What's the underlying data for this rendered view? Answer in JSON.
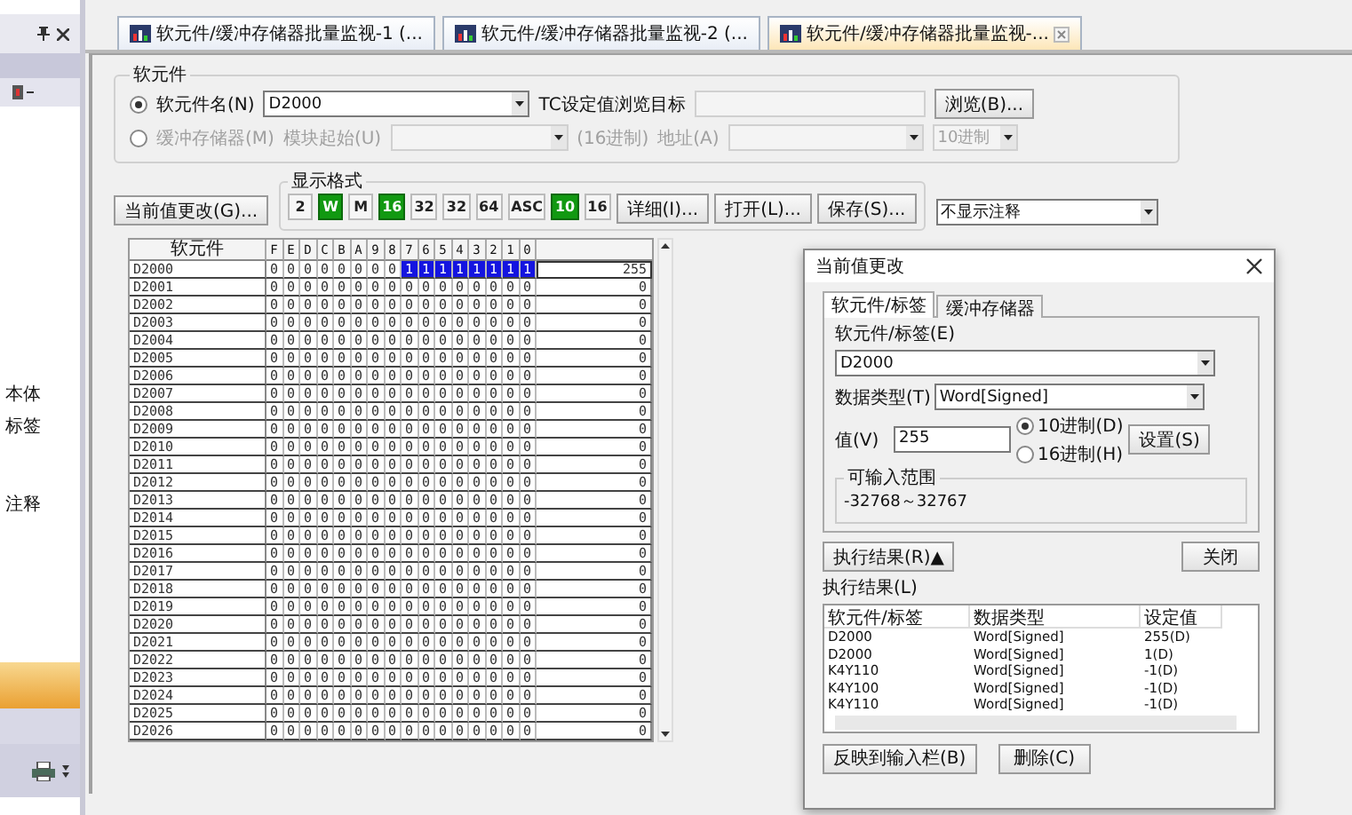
{
  "sidebar": {
    "items": [
      {
        "label": "本体"
      },
      {
        "label": "标签"
      },
      {
        "label": "注释"
      }
    ]
  },
  "tabs": [
    {
      "label": "软元件/缓冲存储器批量监视-1 (...",
      "selected": false
    },
    {
      "label": "软元件/缓冲存储器批量监视-2 (...",
      "selected": false
    },
    {
      "label": "软元件/缓冲存储器批量监视-...",
      "selected": true
    }
  ],
  "device_group": {
    "title": "软元件",
    "radios": [
      {
        "label": "软元件名(N)",
        "selected": true
      },
      {
        "label": "缓冲存储器(M)",
        "selected": false
      }
    ],
    "device_value": "D2000",
    "tc_label": "TC设定值浏览目标",
    "browse_button": "浏览(B)...",
    "module_start_label": "模块起始(U)",
    "hex_note": "(16进制)",
    "address_label": "地址(A)",
    "radix_value": "10进制"
  },
  "change_button": "当前值更改(G)...",
  "format_group": {
    "title": "显示格式",
    "buttons": [
      {
        "label": "2",
        "selected": false
      },
      {
        "label": "W",
        "selected": true
      },
      {
        "label": "M",
        "selected": false
      },
      {
        "label": "16",
        "selected": true
      },
      {
        "label": "32",
        "selected": false
      },
      {
        "label": "32",
        "selected": false
      },
      {
        "label": "64",
        "selected": false
      },
      {
        "label": "ASC",
        "selected": false
      },
      {
        "label": "10",
        "selected": true
      },
      {
        "label": "16",
        "selected": false
      }
    ]
  },
  "detail_button": "详细(I)...",
  "open_button": "打开(L)...",
  "save_button": "保存(S)...",
  "comment_select": "不显示注释",
  "table": {
    "name_header": "软元件",
    "bit_columns": [
      {
        "label": "F",
        "selected": false
      },
      {
        "label": "E",
        "selected": false
      },
      {
        "label": "D",
        "selected": false
      },
      {
        "label": "C",
        "selected": false
      },
      {
        "label": "B",
        "selected": false
      },
      {
        "label": "A",
        "selected": false
      },
      {
        "label": "9",
        "selected": false
      },
      {
        "label": "8",
        "selected": false
      },
      {
        "label": "7",
        "selected": true
      },
      {
        "label": "6",
        "selected": true
      },
      {
        "label": "5",
        "selected": true
      },
      {
        "label": "4",
        "selected": true
      },
      {
        "label": "3",
        "selected": true
      },
      {
        "label": "2",
        "selected": true
      },
      {
        "label": "1",
        "selected": true
      },
      {
        "label": "0",
        "selected": true
      }
    ],
    "rows": [
      {
        "name": "D2000",
        "bits": [
          "0",
          "0",
          "0",
          "0",
          "0",
          "0",
          "0",
          "0",
          "1",
          "1",
          "1",
          "1",
          "1",
          "1",
          "1",
          "1"
        ],
        "value": "255",
        "selected": true
      },
      {
        "name": "D2001",
        "bits": [
          "0",
          "0",
          "0",
          "0",
          "0",
          "0",
          "0",
          "0",
          "0",
          "0",
          "0",
          "0",
          "0",
          "0",
          "0",
          "0"
        ],
        "value": "0",
        "selected": false
      },
      {
        "name": "D2002",
        "bits": [
          "0",
          "0",
          "0",
          "0",
          "0",
          "0",
          "0",
          "0",
          "0",
          "0",
          "0",
          "0",
          "0",
          "0",
          "0",
          "0"
        ],
        "value": "0",
        "selected": false
      },
      {
        "name": "D2003",
        "bits": [
          "0",
          "0",
          "0",
          "0",
          "0",
          "0",
          "0",
          "0",
          "0",
          "0",
          "0",
          "0",
          "0",
          "0",
          "0",
          "0"
        ],
        "value": "0",
        "selected": false
      },
      {
        "name": "D2004",
        "bits": [
          "0",
          "0",
          "0",
          "0",
          "0",
          "0",
          "0",
          "0",
          "0",
          "0",
          "0",
          "0",
          "0",
          "0",
          "0",
          "0"
        ],
        "value": "0",
        "selected": false
      },
      {
        "name": "D2005",
        "bits": [
          "0",
          "0",
          "0",
          "0",
          "0",
          "0",
          "0",
          "0",
          "0",
          "0",
          "0",
          "0",
          "0",
          "0",
          "0",
          "0"
        ],
        "value": "0",
        "selected": false
      },
      {
        "name": "D2006",
        "bits": [
          "0",
          "0",
          "0",
          "0",
          "0",
          "0",
          "0",
          "0",
          "0",
          "0",
          "0",
          "0",
          "0",
          "0",
          "0",
          "0"
        ],
        "value": "0",
        "selected": false
      },
      {
        "name": "D2007",
        "bits": [
          "0",
          "0",
          "0",
          "0",
          "0",
          "0",
          "0",
          "0",
          "0",
          "0",
          "0",
          "0",
          "0",
          "0",
          "0",
          "0"
        ],
        "value": "0",
        "selected": false
      },
      {
        "name": "D2008",
        "bits": [
          "0",
          "0",
          "0",
          "0",
          "0",
          "0",
          "0",
          "0",
          "0",
          "0",
          "0",
          "0",
          "0",
          "0",
          "0",
          "0"
        ],
        "value": "0",
        "selected": false
      },
      {
        "name": "D2009",
        "bits": [
          "0",
          "0",
          "0",
          "0",
          "0",
          "0",
          "0",
          "0",
          "0",
          "0",
          "0",
          "0",
          "0",
          "0",
          "0",
          "0"
        ],
        "value": "0",
        "selected": false
      },
      {
        "name": "D2010",
        "bits": [
          "0",
          "0",
          "0",
          "0",
          "0",
          "0",
          "0",
          "0",
          "0",
          "0",
          "0",
          "0",
          "0",
          "0",
          "0",
          "0"
        ],
        "value": "0",
        "selected": false
      },
      {
        "name": "D2011",
        "bits": [
          "0",
          "0",
          "0",
          "0",
          "0",
          "0",
          "0",
          "0",
          "0",
          "0",
          "0",
          "0",
          "0",
          "0",
          "0",
          "0"
        ],
        "value": "0",
        "selected": false
      },
      {
        "name": "D2012",
        "bits": [
          "0",
          "0",
          "0",
          "0",
          "0",
          "0",
          "0",
          "0",
          "0",
          "0",
          "0",
          "0",
          "0",
          "0",
          "0",
          "0"
        ],
        "value": "0",
        "selected": false
      },
      {
        "name": "D2013",
        "bits": [
          "0",
          "0",
          "0",
          "0",
          "0",
          "0",
          "0",
          "0",
          "0",
          "0",
          "0",
          "0",
          "0",
          "0",
          "0",
          "0"
        ],
        "value": "0",
        "selected": false
      },
      {
        "name": "D2014",
        "bits": [
          "0",
          "0",
          "0",
          "0",
          "0",
          "0",
          "0",
          "0",
          "0",
          "0",
          "0",
          "0",
          "0",
          "0",
          "0",
          "0"
        ],
        "value": "0",
        "selected": false
      },
      {
        "name": "D2015",
        "bits": [
          "0",
          "0",
          "0",
          "0",
          "0",
          "0",
          "0",
          "0",
          "0",
          "0",
          "0",
          "0",
          "0",
          "0",
          "0",
          "0"
        ],
        "value": "0",
        "selected": false
      },
      {
        "name": "D2016",
        "bits": [
          "0",
          "0",
          "0",
          "0",
          "0",
          "0",
          "0",
          "0",
          "0",
          "0",
          "0",
          "0",
          "0",
          "0",
          "0",
          "0"
        ],
        "value": "0",
        "selected": false
      },
      {
        "name": "D2017",
        "bits": [
          "0",
          "0",
          "0",
          "0",
          "0",
          "0",
          "0",
          "0",
          "0",
          "0",
          "0",
          "0",
          "0",
          "0",
          "0",
          "0"
        ],
        "value": "0",
        "selected": false
      },
      {
        "name": "D2018",
        "bits": [
          "0",
          "0",
          "0",
          "0",
          "0",
          "0",
          "0",
          "0",
          "0",
          "0",
          "0",
          "0",
          "0",
          "0",
          "0",
          "0"
        ],
        "value": "0",
        "selected": false
      },
      {
        "name": "D2019",
        "bits": [
          "0",
          "0",
          "0",
          "0",
          "0",
          "0",
          "0",
          "0",
          "0",
          "0",
          "0",
          "0",
          "0",
          "0",
          "0",
          "0"
        ],
        "value": "0",
        "selected": false
      },
      {
        "name": "D2020",
        "bits": [
          "0",
          "0",
          "0",
          "0",
          "0",
          "0",
          "0",
          "0",
          "0",
          "0",
          "0",
          "0",
          "0",
          "0",
          "0",
          "0"
        ],
        "value": "0",
        "selected": false
      },
      {
        "name": "D2021",
        "bits": [
          "0",
          "0",
          "0",
          "0",
          "0",
          "0",
          "0",
          "0",
          "0",
          "0",
          "0",
          "0",
          "0",
          "0",
          "0",
          "0"
        ],
        "value": "0",
        "selected": false
      },
      {
        "name": "D2022",
        "bits": [
          "0",
          "0",
          "0",
          "0",
          "0",
          "0",
          "0",
          "0",
          "0",
          "0",
          "0",
          "0",
          "0",
          "0",
          "0",
          "0"
        ],
        "value": "0",
        "selected": false
      },
      {
        "name": "D2023",
        "bits": [
          "0",
          "0",
          "0",
          "0",
          "0",
          "0",
          "0",
          "0",
          "0",
          "0",
          "0",
          "0",
          "0",
          "0",
          "0",
          "0"
        ],
        "value": "0",
        "selected": false
      },
      {
        "name": "D2024",
        "bits": [
          "0",
          "0",
          "0",
          "0",
          "0",
          "0",
          "0",
          "0",
          "0",
          "0",
          "0",
          "0",
          "0",
          "0",
          "0",
          "0"
        ],
        "value": "0",
        "selected": false
      },
      {
        "name": "D2025",
        "bits": [
          "0",
          "0",
          "0",
          "0",
          "0",
          "0",
          "0",
          "0",
          "0",
          "0",
          "0",
          "0",
          "0",
          "0",
          "0",
          "0"
        ],
        "value": "0",
        "selected": false
      },
      {
        "name": "D2026",
        "bits": [
          "0",
          "0",
          "0",
          "0",
          "0",
          "0",
          "0",
          "0",
          "0",
          "0",
          "0",
          "0",
          "0",
          "0",
          "0",
          "0"
        ],
        "value": "0",
        "selected": false
      }
    ]
  },
  "dialog": {
    "title": "当前值更改",
    "tabs": [
      {
        "label": "软元件/标签",
        "selected": true
      },
      {
        "label": "缓冲存储器",
        "selected": false
      }
    ],
    "device_label": "软元件/标签(E)",
    "device_value": "D2000",
    "type_label": "数据类型(T)",
    "type_value": "Word[Signed]",
    "value_label": "值(V)",
    "value": "255",
    "radix_options": [
      {
        "label": "10进制(D)",
        "selected": true
      },
      {
        "label": "16进制(H)",
        "selected": false
      }
    ],
    "set_button": "设置(S)",
    "range_title": "可输入范围",
    "range_text": "-32768～32767",
    "result_toggle": "执行结果(R)▲",
    "close_button": "关闭",
    "results_label": "执行结果(L)",
    "results": {
      "columns": [
        "软元件/标签",
        "数据类型",
        "设定值"
      ],
      "rows": [
        [
          "D2000",
          "Word[Signed]",
          "255(D)"
        ],
        [
          "D2000",
          "Word[Signed]",
          "1(D)"
        ],
        [
          "K4Y110",
          "Word[Signed]",
          "-1(D)"
        ],
        [
          "K4Y100",
          "Word[Signed]",
          "-1(D)"
        ],
        [
          "K4Y110",
          "Word[Signed]",
          "-1(D)"
        ]
      ]
    },
    "reflect_button": "反映到输入栏(B)",
    "delete_button": "删除(C)"
  }
}
